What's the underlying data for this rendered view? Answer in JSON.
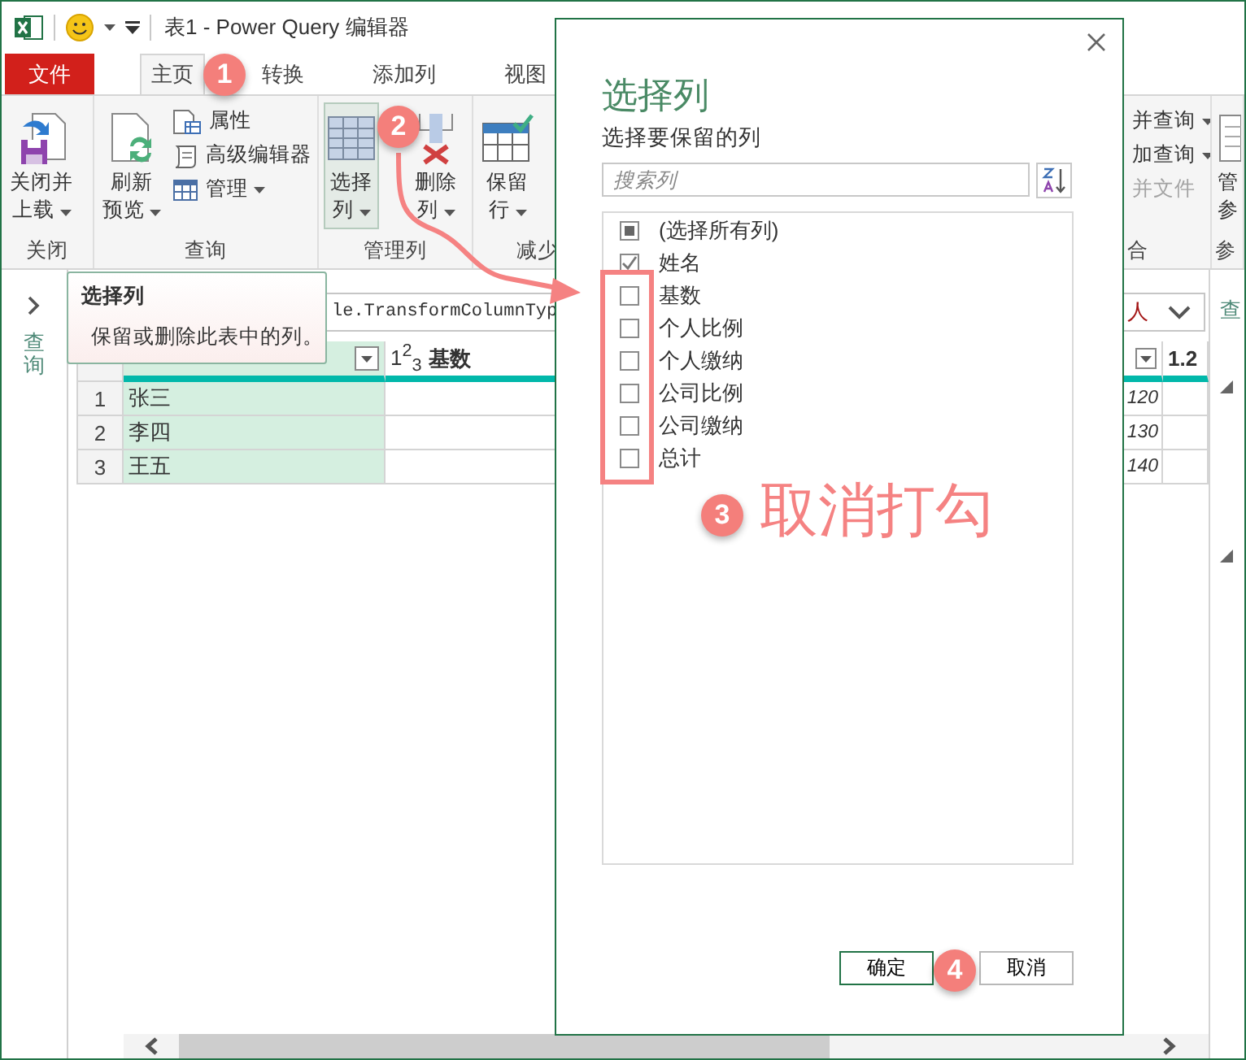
{
  "window": {
    "title": "表1 - Power Query 编辑器"
  },
  "tabs": [
    {
      "label": "文件",
      "kind": "file",
      "selected": false
    },
    {
      "label": "主页",
      "kind": "tab",
      "selected": true
    },
    {
      "label": "转换",
      "kind": "tab",
      "selected": false
    },
    {
      "label": "添加列",
      "kind": "tab",
      "selected": false
    },
    {
      "label": "视图",
      "kind": "tab",
      "selected": false
    }
  ],
  "ribbon": {
    "groups": [
      {
        "label": "关闭",
        "items": [
          {
            "kind": "large",
            "lines": [
              "关闭并",
              "上载"
            ],
            "dropdown": true,
            "pressed": false
          }
        ]
      },
      {
        "label": "查询",
        "items": [
          {
            "kind": "large",
            "lines": [
              "刷新",
              "预览"
            ],
            "dropdown": true,
            "pressed": false
          },
          {
            "kind": "stack",
            "entries": [
              {
                "label": "属性",
                "dropdown": false,
                "disabled": false
              },
              {
                "label": "高级编辑器",
                "dropdown": false,
                "disabled": false
              },
              {
                "label": "管理",
                "dropdown": true,
                "disabled": false
              }
            ]
          }
        ]
      },
      {
        "label": "管理列",
        "items": [
          {
            "kind": "large",
            "lines": [
              "选择",
              "列"
            ],
            "dropdown": true,
            "pressed": true
          },
          {
            "kind": "large",
            "lines": [
              "删除",
              "列"
            ],
            "dropdown": true,
            "pressed": false
          }
        ]
      },
      {
        "label": "减少",
        "items": [
          {
            "kind": "large",
            "lines": [
              "保留",
              "行"
            ],
            "dropdown": true,
            "pressed": false
          }
        ]
      },
      {
        "label": "合",
        "items": [
          {
            "kind": "stack",
            "entries": [
              {
                "label": "并查询",
                "dropdown": true,
                "disabled": false
              },
              {
                "label": "加查询",
                "dropdown": true,
                "disabled": false
              },
              {
                "label": "并文件",
                "dropdown": false,
                "disabled": true
              }
            ]
          }
        ]
      },
      {
        "label": "参",
        "items": [
          {
            "kind": "large",
            "lines": [
              "管",
              "参"
            ],
            "dropdown": false,
            "pressed": false
          }
        ]
      }
    ]
  },
  "navigator": {
    "label": "查询"
  },
  "formula_bar": {
    "text": "le.TransformColumnTyp",
    "text_end": "人"
  },
  "table": {
    "columns": [
      {
        "selected": true
      },
      {
        "type": "1$^{2}$$_{3}$",
        "name": "基数",
        "selected": false
      }
    ],
    "right_column": {
      "type": "1.2"
    },
    "rows": [
      {
        "index": "1",
        "name": "张三",
        "value": "120"
      },
      {
        "index": "2",
        "name": "李四",
        "value": "130"
      },
      {
        "index": "3",
        "name": "王五",
        "value": "140"
      }
    ]
  },
  "query_settings": {
    "label": "查"
  },
  "tooltip": {
    "title": "选择列",
    "body": "保留或删除此表中的列。"
  },
  "dialog": {
    "title": "选择列",
    "subtitle": "选择要保留的列",
    "search_placeholder": "搜索列",
    "items": [
      {
        "label": "(选择所有列)",
        "checked": false,
        "indeterminate": true
      },
      {
        "label": "姓名",
        "checked": true,
        "indeterminate": false
      },
      {
        "label": "基数",
        "checked": false,
        "indeterminate": false
      },
      {
        "label": "个人比例",
        "checked": false,
        "indeterminate": false
      },
      {
        "label": "个人缴纳",
        "checked": false,
        "indeterminate": false
      },
      {
        "label": "公司比例",
        "checked": false,
        "indeterminate": false
      },
      {
        "label": "公司缴纳",
        "checked": false,
        "indeterminate": false
      },
      {
        "label": "总计",
        "checked": false,
        "indeterminate": false
      }
    ],
    "buttons": [
      {
        "label": "确定",
        "default": true
      },
      {
        "label": "取消",
        "default": false
      }
    ]
  },
  "annotations": {
    "steps": [
      "1",
      "2",
      "3",
      "4"
    ],
    "callout": "取消打勾"
  }
}
